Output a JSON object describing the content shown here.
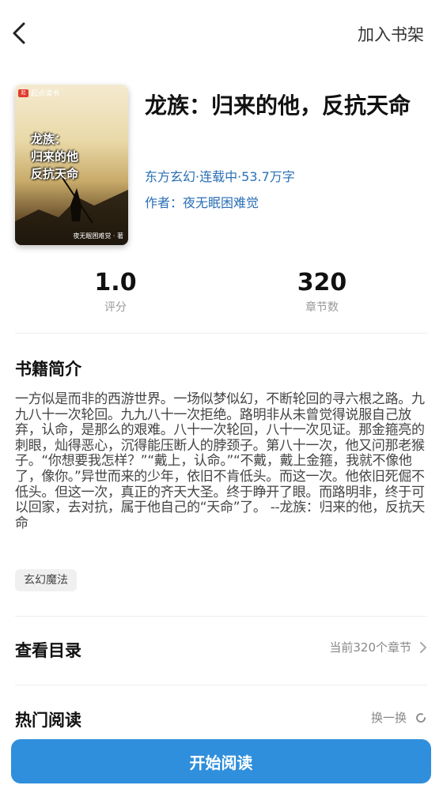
{
  "topbar": {
    "back_label": "<",
    "add_shelf_label": "加入书架"
  },
  "book": {
    "title": "龙族：归来的他，反抗天命",
    "meta": "东方玄幻·连载中·53.7万字",
    "author_label": "作者：夜无眠困难觉",
    "cover": {
      "brand": "起点读书",
      "title_lines": [
        "龙族：",
        "归来的他",
        "反抗天命"
      ],
      "author": "夜无眠困难觉 · 著"
    }
  },
  "stats": {
    "rating_value": "1.0",
    "rating_label": "评分",
    "chapters_value": "320",
    "chapters_label": "章节数"
  },
  "intro": {
    "title": "书籍简介",
    "text": "一方似是而非的西游世界。一场似梦似幻，不断轮回的寻六根之路。九九八十一次轮回。九九八十一次拒绝。路明非从未曾觉得说服自己放弃，认命，是那么的艰难。八十一次轮回，八十一次见证。那金箍亮的刺眼，灿得恶心，沉得能压断人的脖颈子。第八十一次，他又问那老猴子。“你想要我怎样？”“戴上，认命。”“不戴，戴上金箍，我就不像他了，像你。”异世而来的少年，依旧不肯低头。而这一次。他依旧死倔不低头。但这一次，真正的齐天大圣。终于睁开了眼。而路明非，终于可以回家，去对抗，属于他自己的“天命”了。 --龙族：归来的他，反抗天命"
  },
  "tags": [
    "玄幻魔法"
  ],
  "catalog": {
    "title": "查看目录",
    "current": "当前320个章节"
  },
  "hot": {
    "title": "热门阅读",
    "refresh_label": "换一换"
  },
  "start_button": "开始阅读",
  "colors": {
    "accent": "#2f8fdc",
    "link": "#2a6fb5"
  }
}
